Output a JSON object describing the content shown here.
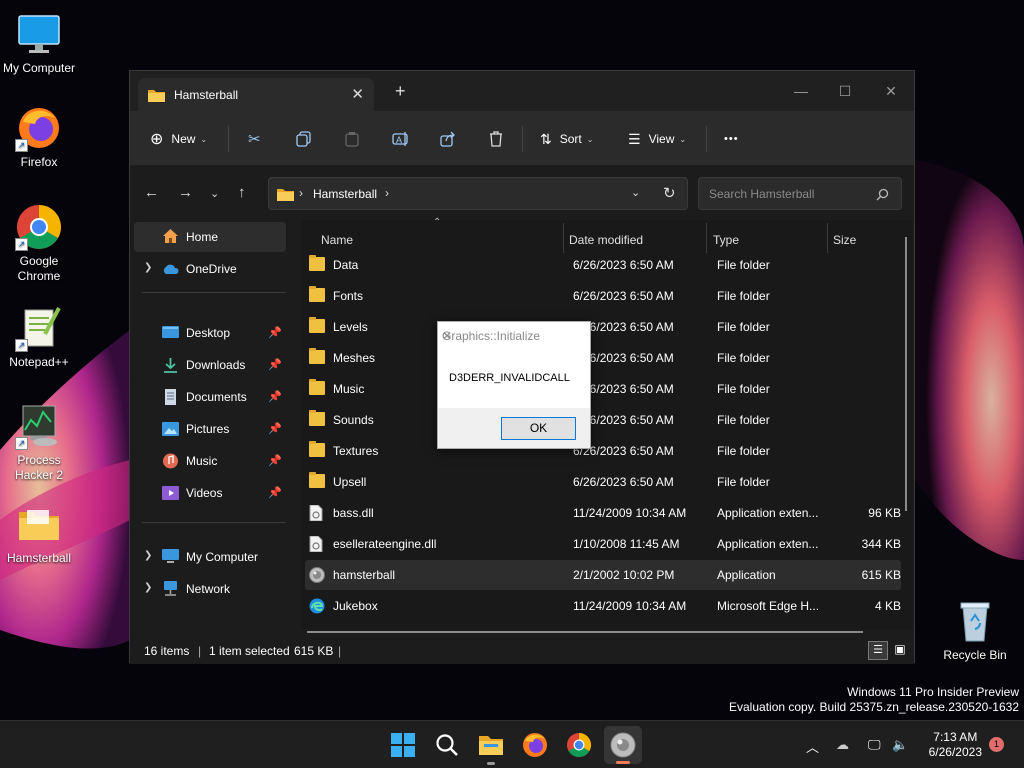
{
  "desktop": {
    "icons": [
      {
        "label": "My Computer",
        "icon": "monitor-icon"
      },
      {
        "label": "Firefox",
        "icon": "firefox-icon"
      },
      {
        "label": "Google Chrome",
        "icon": "chrome-icon"
      },
      {
        "label": "Notepad++",
        "icon": "notepadpp-icon"
      },
      {
        "label": "Process Hacker 2",
        "icon": "process-hacker-icon"
      },
      {
        "label": "Hamsterball",
        "icon": "folder-icon"
      },
      {
        "label": "Recycle Bin",
        "icon": "recycle-bin-icon"
      }
    ]
  },
  "explorer": {
    "tab_title": "Hamsterball",
    "toolbar": {
      "new_label": "New",
      "sort_label": "Sort",
      "view_label": "View",
      "more_label": "•••"
    },
    "address": {
      "path": "Hamsterball",
      "search_placeholder": "Search Hamsterball"
    },
    "nav": {
      "home": "Home",
      "onedrive": "OneDrive",
      "desktop": "Desktop",
      "downloads": "Downloads",
      "documents": "Documents",
      "pictures": "Pictures",
      "music": "Music",
      "videos": "Videos",
      "my_computer": "My Computer",
      "network": "Network"
    },
    "columns": {
      "name": "Name",
      "date": "Date modified",
      "type": "Type",
      "size": "Size"
    },
    "files": [
      {
        "name": "Data",
        "date": "6/26/2023 6:50 AM",
        "type": "File folder",
        "size": "",
        "kind": "folder"
      },
      {
        "name": "Fonts",
        "date": "6/26/2023 6:50 AM",
        "type": "File folder",
        "size": "",
        "kind": "folder"
      },
      {
        "name": "Levels",
        "date": "6/26/2023 6:50 AM",
        "type": "File folder",
        "size": "",
        "kind": "folder"
      },
      {
        "name": "Meshes",
        "date": "6/26/2023 6:50 AM",
        "type": "File folder",
        "size": "",
        "kind": "folder"
      },
      {
        "name": "Music",
        "date": "6/26/2023 6:50 AM",
        "type": "File folder",
        "size": "",
        "kind": "folder"
      },
      {
        "name": "Sounds",
        "date": "6/26/2023 6:50 AM",
        "type": "File folder",
        "size": "",
        "kind": "folder"
      },
      {
        "name": "Textures",
        "date": "6/26/2023 6:50 AM",
        "type": "File folder",
        "size": "",
        "kind": "folder"
      },
      {
        "name": "Upsell",
        "date": "6/26/2023 6:50 AM",
        "type": "File folder",
        "size": "",
        "kind": "folder"
      },
      {
        "name": "bass.dll",
        "date": "11/24/2009 10:34 AM",
        "type": "Application exten...",
        "size": "96 KB",
        "kind": "dll"
      },
      {
        "name": "esellerateengine.dll",
        "date": "1/10/2008 11:45 AM",
        "type": "Application exten...",
        "size": "344 KB",
        "kind": "dll"
      },
      {
        "name": "hamsterball",
        "date": "2/1/2002 10:02 PM",
        "type": "Application",
        "size": "615 KB",
        "kind": "app"
      },
      {
        "name": "Jukebox",
        "date": "11/24/2009 10:34 AM",
        "type": "Microsoft Edge H...",
        "size": "4 KB",
        "kind": "edge"
      }
    ],
    "status": {
      "items": "16 items",
      "selected": "1 item selected",
      "selected_size": "615 KB"
    }
  },
  "dialog": {
    "title": "Graphics::Initialize",
    "message": "D3DERR_INVALIDCALL",
    "ok_label": "OK"
  },
  "watermark": {
    "line1": "Windows 11 Pro Insider Preview",
    "line2": "Evaluation copy. Build 25375.zn_release.230520-1632"
  },
  "taskbar": {
    "time": "7:13 AM",
    "date": "6/26/2023",
    "notification_count": "1"
  },
  "colors": {
    "accent": "#0078d7",
    "folder": "#f0c041"
  }
}
